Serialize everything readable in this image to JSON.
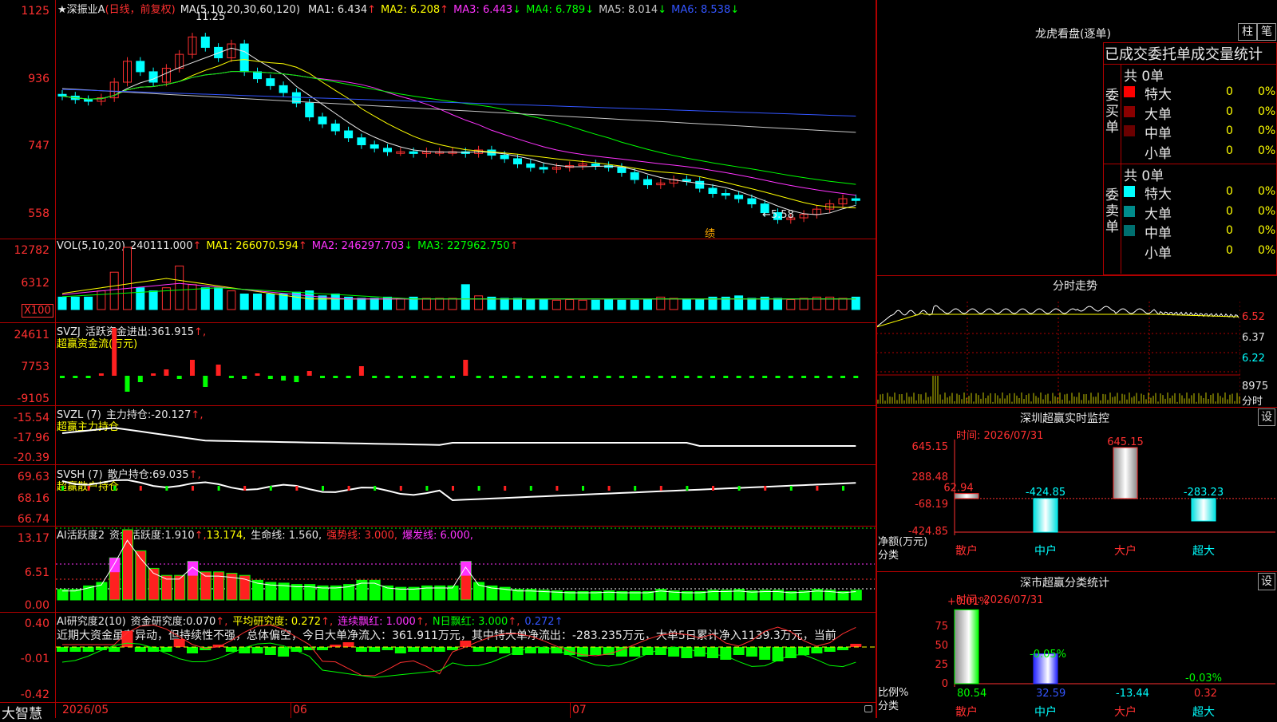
{
  "stock": {
    "star": "★",
    "name": "深振业A",
    "period": "(日线，前复权)"
  },
  "ma_title": {
    "params": "MA(5,10,20,30,60,120)",
    "items": [
      {
        "label": "MA1:",
        "value": "6.434",
        "arrow": "↑",
        "color": "#e8e8e8"
      },
      {
        "label": "MA2:",
        "value": "6.208",
        "arrow": "↑",
        "color": "#ffff00"
      },
      {
        "label": "MA3:",
        "value": "6.443",
        "arrow": "↓",
        "color": "#ff33ff"
      },
      {
        "label": "MA4:",
        "value": "6.789",
        "arrow": "↓",
        "color": "#00ff00"
      },
      {
        "label": "MA5:",
        "value": "8.014",
        "arrow": "↓",
        "color": "#c8c8c8"
      },
      {
        "label": "MA6:",
        "value": "8.538",
        "arrow": "↓",
        "color": "#3355ff"
      }
    ]
  },
  "price_axis": [
    "1125",
    "936",
    "747",
    "558"
  ],
  "price_annotations": {
    "high": "11.25",
    "low": "←5.58",
    "event": "绩"
  },
  "vol": {
    "params": "VOL(5,10,20)",
    "value": "240111.000",
    "arrow": "↑",
    "ma1": "MA1: 266070.594",
    "ma1_arrow": "↑",
    "ma2": "MA2: 246297.703",
    "ma2_arrow": "↓",
    "ma3": "MA3: 227962.750",
    "ma3_arrow": "↑",
    "axis": [
      "12782",
      "6312",
      "X100"
    ]
  },
  "svzj": {
    "name": "SVZJ",
    "label": "活跃资金进出:",
    "value": "361.915",
    "arrow": "↑,",
    "subtitle": "超赢资金流(万元)",
    "axis": [
      "24611",
      "7753",
      "-9105"
    ]
  },
  "svzl": {
    "name": "SVZL (7)",
    "label": "主力持仓:",
    "value": "-20.127",
    "arrow": "↑,",
    "subtitle": "超赢主力持仓",
    "axis": [
      "-15.54",
      "-17.96",
      "-20.39"
    ]
  },
  "svsh": {
    "name": "SVSH (7)",
    "label": "散户持仓:",
    "value": "69.035",
    "arrow": "↑,",
    "subtitle": "超赢散户持仓",
    "axis": [
      "69.63",
      "68.16",
      "66.74"
    ]
  },
  "ai_active": {
    "name": "AI活跃度2",
    "label": "资金活跃度:",
    "value": "1.910",
    "arrow": "↑,",
    "v2": "13.174,",
    "life": "生命线: 1.560,",
    "strong": "强势线: 3.000,",
    "burst": "爆发线: 6.000,",
    "axis": [
      "13.17",
      "6.51",
      "0.00"
    ]
  },
  "ai_research": {
    "name": "AI研究度2(10)",
    "label": "资金研究度:",
    "value": "0.070",
    "arrow": "↑,",
    "avg": "平均研究度: 0.272",
    "avg_arrow": "↑,",
    "cont": "连续飘红: 1.000",
    "cont_arrow": "↑,",
    "nday": "N日飘红: 3.000",
    "nday_arrow": "↑,",
    "last": "0.272↑",
    "text": "近期大资金虽有异动，但持续性不强，总体偏空，今日大单净流入：361.911万元，其中特大单净流出：-283.235万元，大单5日累计净入1139.3万元，当前",
    "axis": [
      "0.40",
      "-0.01",
      "-0.42"
    ]
  },
  "date_axis": [
    "2026/05",
    "06",
    "07"
  ],
  "brand": "大智慧",
  "dragon": {
    "title": "龙虎看盘(逐单)",
    "btn1": "柱",
    "btn2": "笔",
    "header": "已成交委托单成交量统计",
    "buy": {
      "side": "委买单",
      "total": "共 0单",
      "rows": [
        {
          "label": "特大",
          "n": "0",
          "pct": "0%",
          "color": "#ff0000"
        },
        {
          "label": "大单",
          "n": "0",
          "pct": "0%",
          "color": "#8b0000"
        },
        {
          "label": "中单",
          "n": "0",
          "pct": "0%",
          "color": "#6b0000"
        },
        {
          "label": "小单",
          "n": "0",
          "pct": "0%",
          "color": "#000000"
        }
      ]
    },
    "sell": {
      "side": "委卖单",
      "total": "共 0单",
      "rows": [
        {
          "label": "特大",
          "n": "0",
          "pct": "0%",
          "color": "#00ffff"
        },
        {
          "label": "大单",
          "n": "0",
          "pct": "0%",
          "color": "#008b8b"
        },
        {
          "label": "中单",
          "n": "0",
          "pct": "0%",
          "color": "#007070"
        },
        {
          "label": "小单",
          "n": "0",
          "pct": "0%",
          "color": "#000000"
        }
      ]
    }
  },
  "intraday": {
    "title": "分时走势",
    "axis": [
      "6.52",
      "6.37",
      "6.22"
    ],
    "vol_axis": "8975",
    "vol_unit": "分时"
  },
  "monitor": {
    "title": "深圳超赢实时监控",
    "btn": "设",
    "time": "时间: 2026/07/31",
    "axis": [
      "645.15",
      "288.48",
      "-68.19",
      "-424.85"
    ],
    "ylabel": "净额(万元)",
    "xlabel": "分类",
    "chart_data": {
      "type": "bar",
      "categories": [
        "散户",
        "中户",
        "大户",
        "超大"
      ],
      "values": [
        62.94,
        -424.85,
        645.15,
        -283.23
      ],
      "ylim": [
        -424.85,
        645.15
      ],
      "labels": [
        "62.94",
        "-424.85",
        "645.15",
        "-283.23"
      ]
    }
  },
  "classify": {
    "title": "深市超赢分类统计",
    "btn": "设",
    "time": "时间: 2026/07/31",
    "axis": [
      "75",
      "50",
      "25",
      "0"
    ],
    "ylabel": "比例%",
    "xlabel": "分类",
    "top_labels": [
      "+0.01%",
      "-0.05%",
      "-0.03%"
    ],
    "chart_data": {
      "type": "bar",
      "categories": [
        "散户",
        "中户",
        "大户",
        "超大"
      ],
      "values": [
        80.54,
        32.59,
        -13.44,
        0.32
      ],
      "labels": [
        "80.54",
        "32.59",
        "-13.44",
        "0.32"
      ]
    }
  }
}
